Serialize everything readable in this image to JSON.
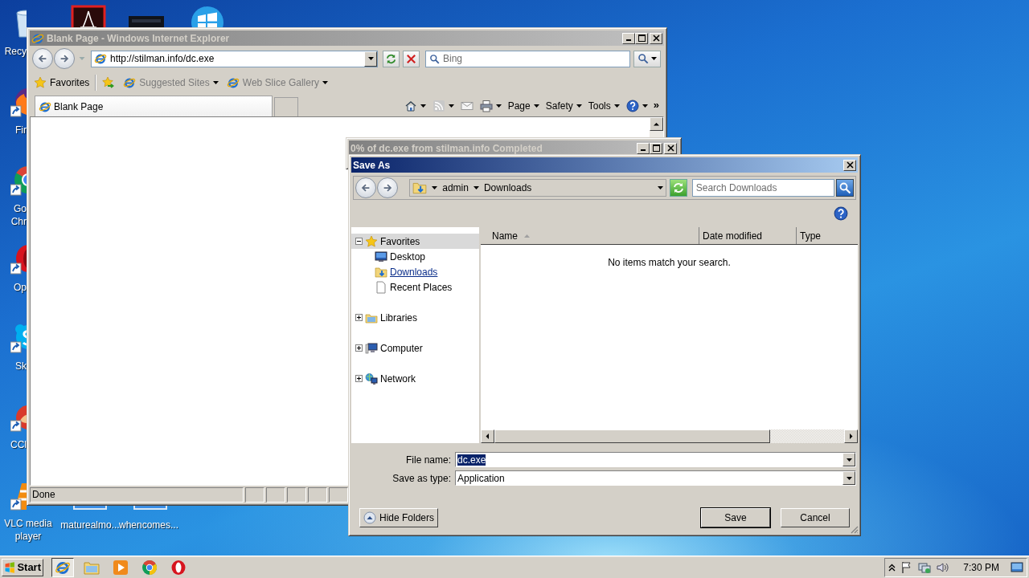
{
  "desktop": {
    "icons": [
      {
        "kind": "recycle",
        "label": "Recy"
      },
      {
        "kind": "firefox",
        "label": "Fir"
      },
      {
        "kind": "chrome",
        "label": "Go\nChr"
      },
      {
        "kind": "opera",
        "label": "Op"
      },
      {
        "kind": "skype",
        "label": "Sk"
      },
      {
        "kind": "ccleaner",
        "label": "CCl"
      },
      {
        "kind": "vlc",
        "label": "VLC media player"
      },
      {
        "kind": "acrobat"
      },
      {
        "kind": "app"
      },
      {
        "kind": "windows"
      },
      {
        "kind": "file",
        "label": "maturealmo..."
      },
      {
        "kind": "file",
        "label": "whencomes..."
      }
    ]
  },
  "browser": {
    "title": "Blank Page - Windows Internet Explorer",
    "active": false,
    "address": "http://stilman.info/dc.exe",
    "search_placeholder": "Bing",
    "favorites": "Favorites",
    "links": [
      {
        "label": "Suggested Sites",
        "disabled": true
      },
      {
        "label": "Web Slice Gallery",
        "disabled": true
      }
    ],
    "tabs": [
      {
        "label": "Blank Page",
        "selected": true
      }
    ],
    "commands": [
      {
        "kind": "home"
      },
      {
        "kind": "feeds"
      },
      {
        "kind": "mail"
      },
      {
        "kind": "print"
      },
      {
        "kind": "menu",
        "label": "Page"
      },
      {
        "kind": "menu",
        "label": "Safety"
      },
      {
        "kind": "menu",
        "label": "Tools"
      },
      {
        "kind": "help"
      }
    ],
    "overflow": "»",
    "status": "Done"
  },
  "download_window": {
    "title": "0% of dc.exe from stilman.info Completed"
  },
  "dialog": {
    "title": "Save As",
    "breadcrumb": [
      "admin",
      "Downloads"
    ],
    "search_placeholder": "Search Downloads",
    "tree": [
      {
        "kind": "star",
        "label": "Favorites",
        "expanded": true,
        "selected": true,
        "hovered": false,
        "children": [
          {
            "kind": "desktop",
            "label": "Desktop",
            "selected": false,
            "hovered": false
          },
          {
            "kind": "downloads",
            "label": "Downloads",
            "selected": false,
            "hovered": true
          },
          {
            "kind": "recent",
            "label": "Recent Places",
            "selected": false,
            "hovered": false
          }
        ]
      },
      {
        "kind": "libraries",
        "label": "Libraries",
        "expanded": false,
        "selected": false,
        "hovered": false
      },
      {
        "kind": "computer",
        "label": "Computer",
        "expanded": false,
        "selected": false,
        "hovered": false
      },
      {
        "kind": "network",
        "label": "Network",
        "expanded": false,
        "selected": false,
        "hovered": false
      }
    ],
    "columns": [
      {
        "label": "Name",
        "sorted": true
      },
      {
        "label": "Date modified",
        "sorted": false
      },
      {
        "label": "Type",
        "sorted": false
      }
    ],
    "empty_message": "No items match your search.",
    "file_name_label": "File name:",
    "file_name": "dc.exe",
    "file_name_selected": true,
    "type_label": "Save as type:",
    "type": "Application",
    "hide_folders": "Hide Folders",
    "buttons": [
      {
        "label": "Save",
        "default": true
      },
      {
        "label": "Cancel",
        "default": false
      }
    ]
  },
  "taskbar": {
    "start": "Start",
    "apps": [
      {
        "kind": "ie",
        "selected": true
      },
      {
        "kind": "explorer",
        "selected": false
      },
      {
        "kind": "media",
        "selected": false
      },
      {
        "kind": "chrome",
        "selected": false
      },
      {
        "kind": "opera",
        "selected": false
      }
    ],
    "time": "7:30 PM"
  }
}
